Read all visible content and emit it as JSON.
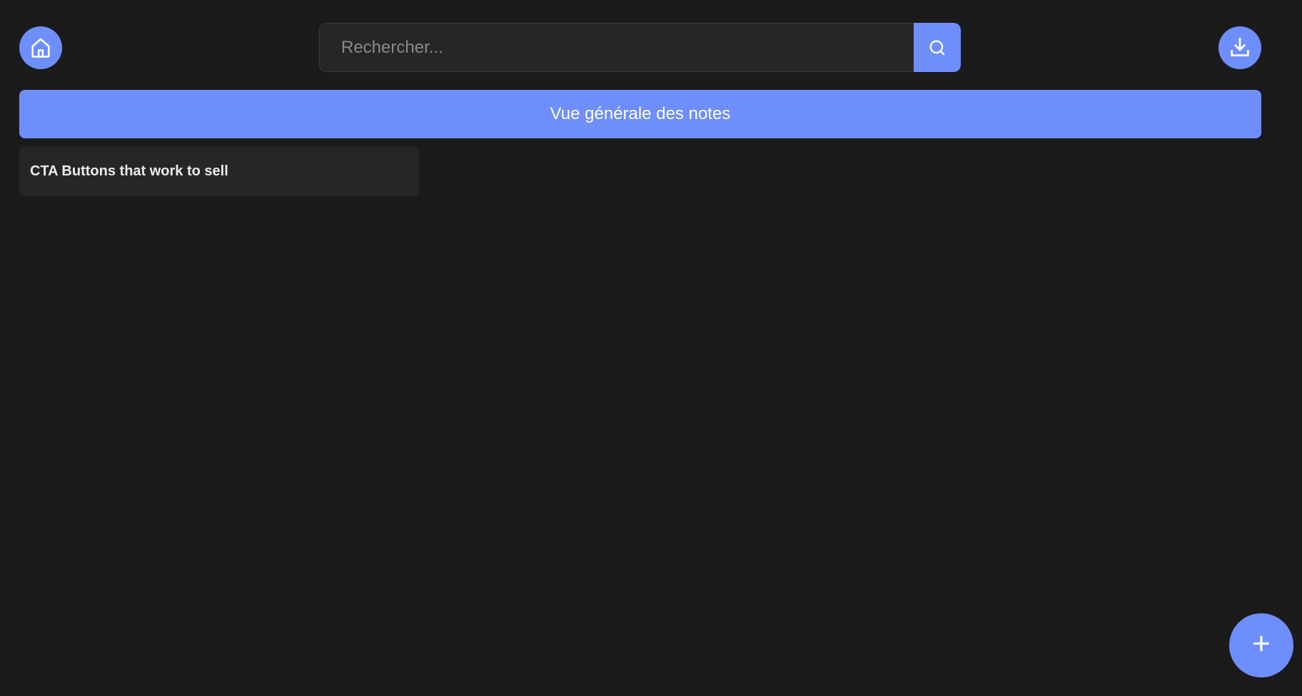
{
  "header": {
    "home_icon": "home-icon",
    "download_icon": "download-icon",
    "search": {
      "placeholder": "Rechercher...",
      "value": "",
      "button_icon": "search-icon"
    }
  },
  "overview": {
    "label": "Vue générale des notes"
  },
  "notes": [
    {
      "title": "CTA Buttons that work to sell"
    }
  ],
  "fab": {
    "label": "+",
    "icon": "plus-icon"
  },
  "colors": {
    "background": "#1b1b1b",
    "accent": "#6e8efb",
    "card": "#262626",
    "text": "#ffffff"
  }
}
